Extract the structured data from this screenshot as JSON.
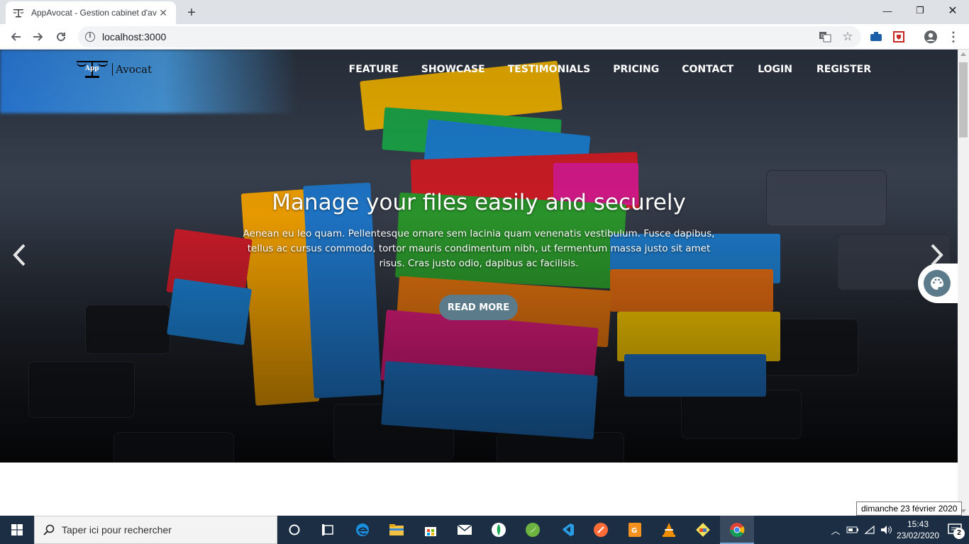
{
  "browser": {
    "tab_title": "AppAvocat - Gestion cabinet d'av",
    "url": "localhost:3000"
  },
  "site": {
    "logo_app": "App",
    "logo_name": "Avocat",
    "nav": [
      "FEATURE",
      "SHOWCASE",
      "TESTIMONIALS",
      "PRICING",
      "CONTACT",
      "LOGIN",
      "REGISTER"
    ],
    "hero_title": "Manage your files easily and securely",
    "hero_text": "Aenean eu leo quam. Pellentesque ornare sem lacinia quam venenatis vestibulum. Fusce dapibus, tellus ac cursus commodo, tortor mauris condimentum nibh, ut fermentum massa justo sit amet risus. Cras justo odio, dapibus ac facilisis.",
    "cta_label": "READ MORE",
    "accent": "#5b7a8a"
  },
  "tooltip": "dimanche 23 février 2020",
  "taskbar": {
    "search_placeholder": "Taper ici pour rechercher",
    "time": "15:43",
    "date": "23/02/2020",
    "notifications": "2",
    "apps": [
      "cortana-icon",
      "task-view-icon",
      "edge-icon",
      "file-explorer-icon",
      "store-icon",
      "mail-icon",
      "mongodb-compass-icon",
      "spring-tool-suite-icon",
      "vscode-icon",
      "postman-icon",
      "pdf-app-icon",
      "vlc-icon",
      "git-icon",
      "chrome-icon"
    ]
  }
}
